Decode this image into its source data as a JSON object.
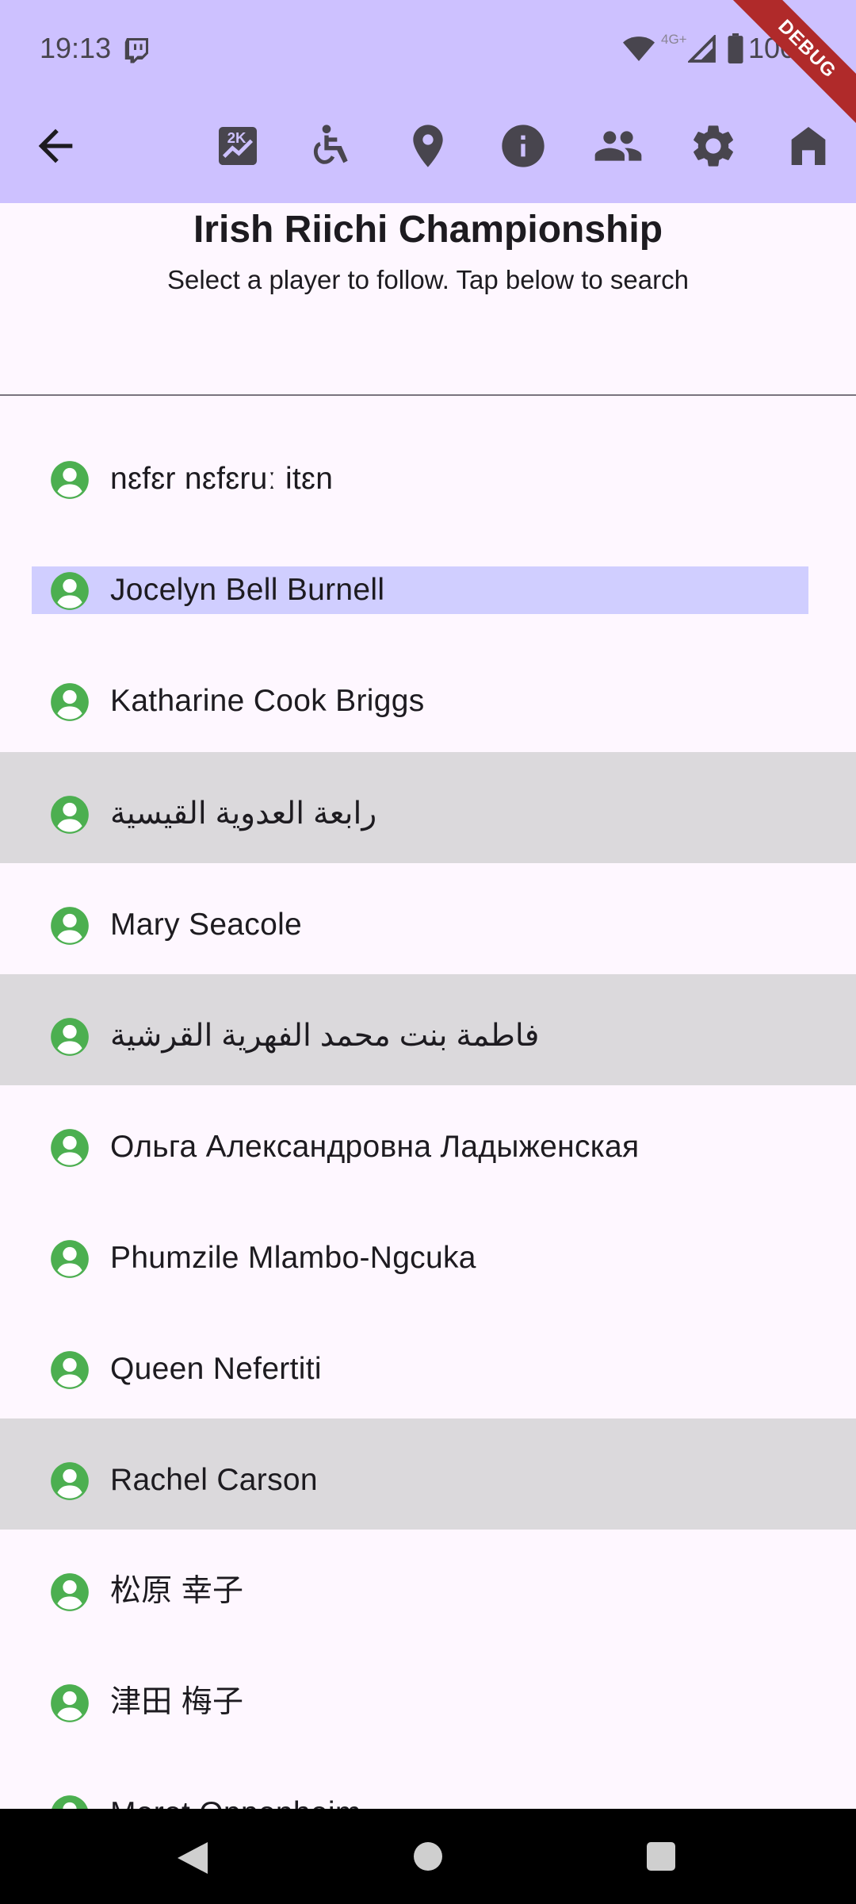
{
  "status_bar": {
    "time": "19:13",
    "network": "4G+",
    "battery": "100%",
    "debug_banner": "DEBUG"
  },
  "toolbar": {
    "icons": [
      "back-arrow-icon",
      "rankings-icon",
      "accessibility-icon",
      "location-icon",
      "info-icon",
      "players-icon",
      "settings-icon",
      "home-icon"
    ]
  },
  "header": {
    "title": "Irish Riichi Championship",
    "subtitle": "Select a player to follow. Tap below to search"
  },
  "players": [
    {
      "name": "nɛfɛr nɛfɛruː itɛn",
      "state": "normal"
    },
    {
      "name": "Jocelyn Bell Burnell",
      "state": "selected"
    },
    {
      "name": "Katharine Cook Briggs",
      "state": "normal"
    },
    {
      "name": "رابعة العدوية القيسية",
      "state": "highlight"
    },
    {
      "name": "Mary Seacole",
      "state": "normal"
    },
    {
      "name": "فاطمة بنت محمد الفهرية القرشية",
      "state": "highlight"
    },
    {
      "name": "Ольга Александровна Ладыженская",
      "state": "normal"
    },
    {
      "name": "Phumzile Mlambo-Ngcuka",
      "state": "normal"
    },
    {
      "name": "Queen Nefertiti",
      "state": "normal"
    },
    {
      "name": "Rachel Carson",
      "state": "highlight"
    },
    {
      "name": "松原 幸子",
      "state": "normal"
    },
    {
      "name": "津田 梅子",
      "state": "normal"
    },
    {
      "name": "Meret Oppenheim",
      "state": "normal"
    }
  ],
  "colors": {
    "app_bar": "#cdc1ff",
    "background": "#fef7ff",
    "person_icon": "#4caf50",
    "row_highlight": "#dbd9dc",
    "row_selected": "#d0ceff"
  },
  "nav_bar": {
    "icons": [
      "back-triangle-icon",
      "home-circle-icon",
      "recents-square-icon"
    ]
  }
}
